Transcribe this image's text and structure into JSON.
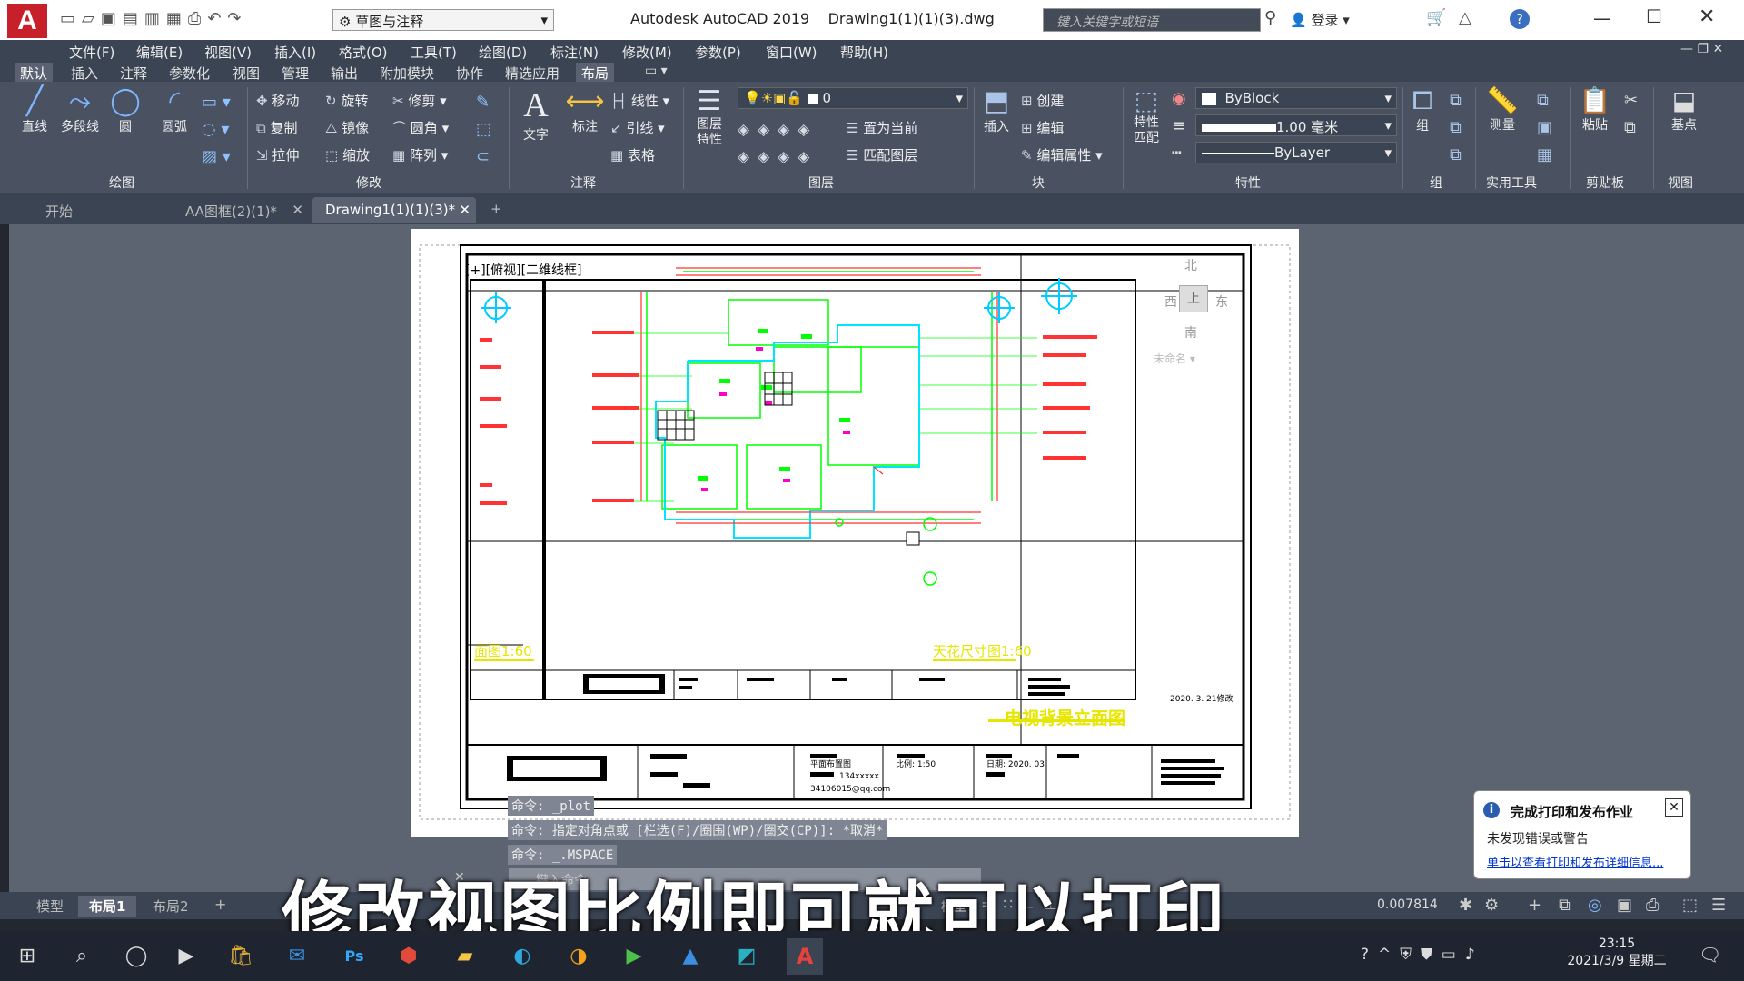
{
  "title_bar": {
    "workspace": "草图与注释",
    "app_title": "Autodesk AutoCAD 2019",
    "doc_title": "Drawing1(1)(1)(3).dwg",
    "search_placeholder": "键入关键字或短语",
    "login": "登录"
  },
  "menu": [
    "文件(F)",
    "编辑(E)",
    "视图(V)",
    "插入(I)",
    "格式(O)",
    "工具(T)",
    "绘图(D)",
    "标注(N)",
    "修改(M)",
    "参数(P)",
    "窗口(W)",
    "帮助(H)"
  ],
  "ribbon_tabs": [
    "默认",
    "插入",
    "注释",
    "参数化",
    "视图",
    "管理",
    "输出",
    "附加模块",
    "协作",
    "精选应用",
    "布局"
  ],
  "ribbon": {
    "draw": {
      "line": "直线",
      "polyline": "多段线",
      "circle": "圆",
      "arc": "圆弧",
      "panel": "绘图"
    },
    "modify": {
      "move": "移动",
      "rotate": "旋转",
      "trim": "修剪",
      "copy": "复制",
      "mirror": "镜像",
      "fillet": "圆角",
      "stretch": "拉伸",
      "scale": "缩放",
      "array": "阵列",
      "panel": "修改"
    },
    "annotation": {
      "text": "文字",
      "dimension": "标注",
      "linetype": "线性",
      "leader": "引线",
      "table": "表格",
      "panel": "注释"
    },
    "layers": {
      "layer_props": "图层特性",
      "current_layer": "0",
      "set_current": "置为当前",
      "match_layer": "匹配图层",
      "panel": "图层"
    },
    "block": {
      "insert": "插入",
      "create": "创建",
      "edit": "编辑",
      "edit_attr": "编辑属性",
      "panel": "块"
    },
    "properties": {
      "match": "特性匹配",
      "color": "ByBlock",
      "lineweight": "1.00 毫米",
      "linetype": "ByLayer",
      "panel": "特性"
    },
    "group": {
      "group": "组",
      "panel": "组"
    },
    "utilities": {
      "measure": "测量",
      "panel": "实用工具"
    },
    "clipboard": {
      "paste": "粘贴",
      "panel": "剪贴板"
    },
    "view": {
      "base": "基点",
      "panel": "视图"
    }
  },
  "doc_tabs": [
    "开始",
    "AA图框(2)(1)*",
    "Drawing1(1)(1)(3)*"
  ],
  "viewport": {
    "label": "[+][俯视][二维线框]",
    "compass_north": "北",
    "compass_south": "南",
    "compass_west": "西",
    "compass_east": "东",
    "compass_top": "上",
    "ucs_name": "未命名",
    "title_left": "面图1:60",
    "title_right": "天花尺寸图1:60",
    "title_elevation": "电视背景立面图",
    "date_note": "2020. 3. 21修改",
    "scale_label": "比例: 1:50",
    "date_label": "日期: 2020. 03",
    "plan_label": "平面布置图",
    "phone": "134xxxxx",
    "email": "34106015@qq.com"
  },
  "command_history": [
    "命令: _plot",
    "命令: 指定对角点或 [栏选(F)/圈围(WP)/圈交(CP)]: *取消*",
    "命令: _.MSPACE"
  ],
  "command_placeholder": "键入命令",
  "layout_tabs": [
    "模型",
    "布局1",
    "布局2"
  ],
  "status": {
    "model": "模型",
    "scale": "0.007814"
  },
  "caption": "修改视图比例即可就可以打印",
  "notification": {
    "title": "完成打印和发布作业",
    "body": "未发现错误或警告",
    "link": "单击以查看打印和发布详细信息..."
  },
  "taskbar": {
    "time": "23:15",
    "date": "2021/3/9 星期二"
  },
  "colors": {
    "accent": "#c8202b",
    "ribbon_bg": "#4a5262",
    "cad_yellow": "#ffff00",
    "cad_cyan": "#00e5ff",
    "cad_red": "#ff3030",
    "cad_green": "#00ff00"
  }
}
